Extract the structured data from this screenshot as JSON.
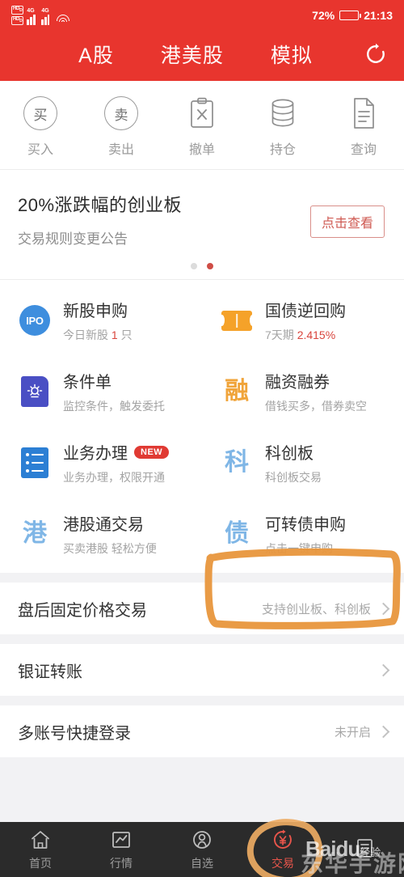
{
  "statusbar": {
    "volte_1": "HD",
    "volte_2": "HD",
    "network_1": "4G",
    "network_2": "4G",
    "wifi_icon": "wifi-icon",
    "battery_percent": "72%",
    "battery_level": 72,
    "time": "21:13"
  },
  "topbar": {
    "tabs": [
      {
        "label": "A股",
        "active": true
      },
      {
        "label": "港美股",
        "active": false
      },
      {
        "label": "模拟",
        "active": false
      }
    ],
    "refresh_icon": "refresh-icon",
    "brand_color": "#e8352e"
  },
  "quick_actions": [
    {
      "label": "买入",
      "icon": "buy-circle-icon",
      "glyph": "买"
    },
    {
      "label": "卖出",
      "icon": "sell-circle-icon",
      "glyph": "卖"
    },
    {
      "label": "撤单",
      "icon": "cancel-order-clipboard-icon",
      "glyph": ""
    },
    {
      "label": "持仓",
      "icon": "holdings-database-icon",
      "glyph": ""
    },
    {
      "label": "查询",
      "icon": "query-document-icon",
      "glyph": ""
    }
  ],
  "banner": {
    "title": "20%涨跌幅的创业板",
    "subtitle": "交易规则变更公告",
    "button_label": "点击查看",
    "dots_total": 2,
    "dots_active_index": 1,
    "accent_color": "#cf5a52"
  },
  "services": [
    {
      "title": "新股申购",
      "subtitle_prefix": "今日新股 ",
      "subtitle_highlight": "1",
      "subtitle_suffix": " 只",
      "icon": "ipo-circle-icon",
      "icon_text": "IPO",
      "badge": ""
    },
    {
      "title": "国债逆回购",
      "subtitle_prefix": "7天期 ",
      "subtitle_highlight": "2.415%",
      "subtitle_suffix": "",
      "icon": "treasury-ticket-icon",
      "icon_text": "",
      "badge": ""
    },
    {
      "title": "条件单",
      "subtitle_prefix": "监控条件，触发委托",
      "subtitle_highlight": "",
      "subtitle_suffix": "",
      "icon": "conditional-order-icon",
      "icon_text": "",
      "badge": ""
    },
    {
      "title": "融资融券",
      "subtitle_prefix": "借钱买多，借券卖空",
      "subtitle_highlight": "",
      "subtitle_suffix": "",
      "icon": "margin-trading-icon",
      "icon_text": "融",
      "badge": ""
    },
    {
      "title": "业务办理",
      "subtitle_prefix": "业务办理，权限开通",
      "subtitle_highlight": "",
      "subtitle_suffix": "",
      "icon": "business-list-icon",
      "icon_text": "",
      "badge": "NEW"
    },
    {
      "title": "科创板",
      "subtitle_prefix": "科创板交易",
      "subtitle_highlight": "",
      "subtitle_suffix": "",
      "icon": "star-market-icon",
      "icon_text": "科",
      "badge": ""
    },
    {
      "title": "港股通交易",
      "subtitle_prefix": "买卖港股 轻松方便",
      "subtitle_highlight": "",
      "subtitle_suffix": "",
      "icon": "hk-connect-icon",
      "icon_text": "港",
      "badge": ""
    },
    {
      "title": "可转债申购",
      "subtitle_prefix": "点击一键申购",
      "subtitle_highlight": "",
      "subtitle_suffix": "",
      "icon": "convertible-bond-icon",
      "icon_text": "债",
      "badge": ""
    }
  ],
  "list_rows": [
    {
      "title": "盘后固定价格交易",
      "meta": "支持创业板、科创板",
      "chevron": "chevron-right-icon"
    },
    {
      "title": "银证转账",
      "meta": "",
      "chevron": "chevron-right-icon"
    },
    {
      "title": "多账号快捷登录",
      "meta": "未开启",
      "chevron": "chevron-right-icon"
    }
  ],
  "bottom_nav": [
    {
      "label": "首页",
      "icon": "home-icon",
      "active": false
    },
    {
      "label": "行情",
      "icon": "market-chart-icon",
      "active": false
    },
    {
      "label": "自选",
      "icon": "watchlist-person-icon",
      "active": false
    },
    {
      "label": "交易",
      "icon": "trade-yuan-icon",
      "active": true
    },
    {
      "label": "",
      "icon": "more-document-icon",
      "active": false
    }
  ],
  "annotations": [
    {
      "name": "highlight-rect-convertible-bond",
      "shape": "rectangle",
      "color": "#e8963c"
    },
    {
      "name": "highlight-circle-trade-tab",
      "shape": "circle",
      "color": "#edab63"
    }
  ],
  "watermarks": {
    "primary": "Baidu",
    "primary_suffix": "经验",
    "secondary": "东华手游网"
  }
}
